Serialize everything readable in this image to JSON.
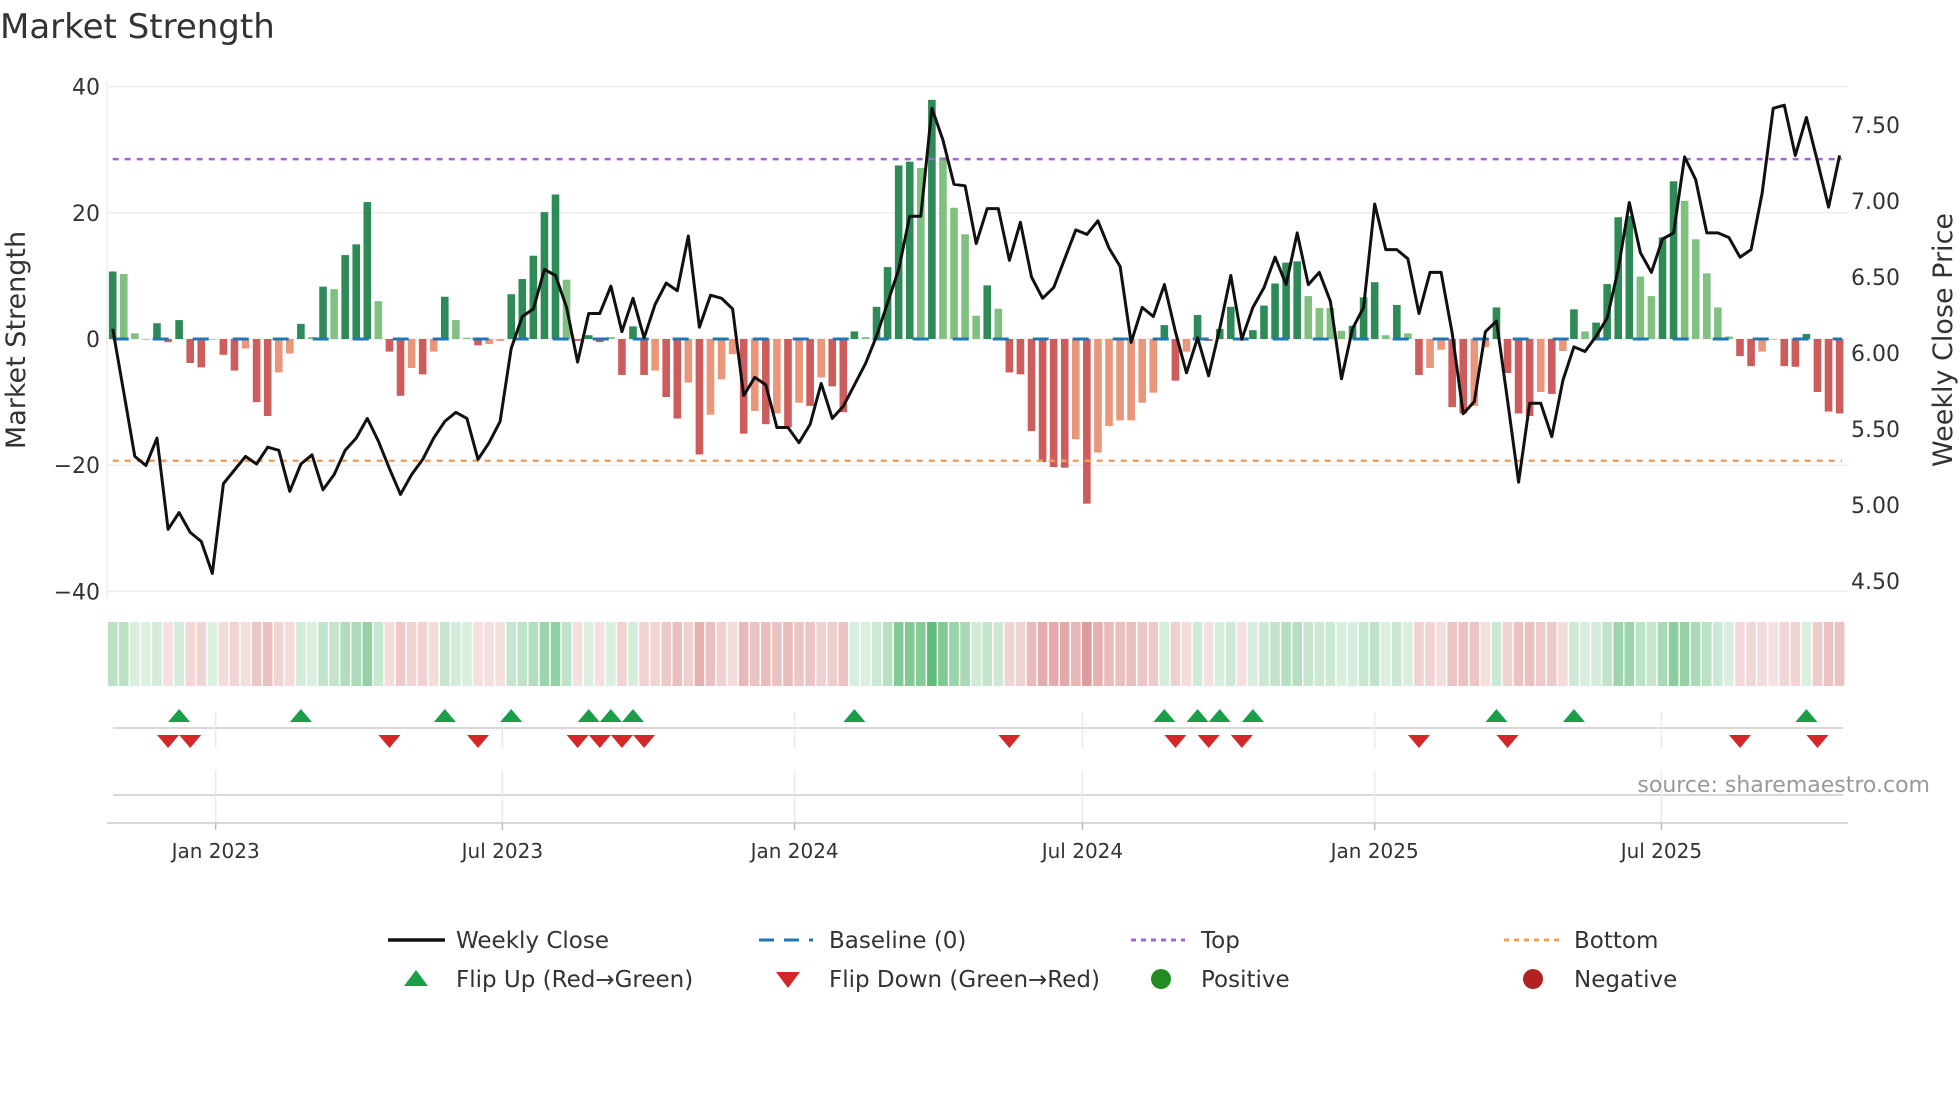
{
  "chart_data": {
    "type": "bar",
    "title": "Market Strength",
    "ylabel": "Market Strength",
    "y2label": "Weekly Close Price",
    "ylim": [
      -40,
      40
    ],
    "y2lim": [
      4.5,
      7.6
    ],
    "yticks": [
      "40",
      "20",
      "0",
      "−20",
      "−40"
    ],
    "ytick_values": [
      40,
      20,
      0,
      -20,
      -40
    ],
    "y2ticks": [
      "7.50",
      "7.00",
      "6.50",
      "6.00",
      "5.50",
      "5.00",
      "4.50"
    ],
    "y2tick_values": [
      7.5,
      7.0,
      6.5,
      6.0,
      5.5,
      5.0,
      4.5
    ],
    "xticks": [
      "Jan 2023",
      "Jul 2023",
      "Jan 2024",
      "Jul 2024",
      "Jan 2025",
      "Jul 2025"
    ],
    "xtick_week_index": [
      9.3,
      35.2,
      61.6,
      87.6,
      114.0,
      139.9
    ],
    "grid": true,
    "top_level": 28.5,
    "bottom_level": -19.3,
    "baseline": 0,
    "strength": [
      10.7,
      10.3,
      0.9,
      0,
      2.5,
      -0.5,
      3.0,
      -3.8,
      -4.5,
      0,
      -2.5,
      -5,
      -1.5,
      -10,
      -12.2,
      -5.3,
      -2.3,
      2.4,
      0.3,
      8.3,
      7.9,
      13.3,
      15,
      21.7,
      6,
      -2,
      -9,
      -4.6,
      -5.6,
      -2,
      6.7,
      3,
      0.2,
      -1,
      -0.8,
      -0.3,
      7.1,
      9.5,
      13.2,
      20.1,
      22.9,
      9.4,
      -0.3,
      0.6,
      -0.5,
      0.3,
      -5.7,
      2,
      -5.7,
      -5,
      -9.2,
      -12.6,
      -6.9,
      -18.3,
      -12,
      -6.4,
      -2.4,
      -15,
      -11.4,
      -13.5,
      -11.8,
      -14,
      -10.1,
      -10.6,
      -6.1,
      -7.5,
      -11.6,
      1.2,
      0.3,
      5.1,
      11.4,
      27.5,
      28.1,
      27.1,
      37.9,
      28.8,
      20.8,
      16.6,
      3.7,
      8.5,
      4.8,
      -5.3,
      -5.6,
      -14.6,
      -19.5,
      -20.3,
      -20.4,
      -15.9,
      -26.1,
      -18,
      -13.8,
      -12.9,
      -12.9,
      -10.1,
      -8.5,
      2.2,
      -6.6,
      -2,
      3.8,
      -0.3,
      1.6,
      5.1,
      -0.2,
      1.4,
      5.3,
      8.8,
      12.1,
      12.3,
      6.8,
      4.9,
      4.9,
      1.3,
      2.1,
      6.6,
      9,
      0.6,
      5.4,
      0.9,
      -5.7,
      -4.6,
      -1.7,
      -10.8,
      -11.8,
      -10.6,
      -1.3,
      5,
      -5.4,
      -11.8,
      -12.2,
      -8.4,
      -8.7,
      -1.9,
      4.7,
      1.2,
      2.6,
      8.7,
      19.3,
      19.5,
      9.9,
      6.8,
      16.1,
      25,
      21.9,
      15.8,
      10.4,
      5,
      0.4,
      -2.7,
      -4.3,
      -2,
      -0.1,
      -4.3,
      -4.4,
      0.8,
      -8.4,
      -11.5,
      -11.8
    ],
    "strength_dark": [
      1,
      0,
      0,
      0,
      1,
      1,
      1,
      1,
      1,
      0,
      1,
      1,
      0,
      1,
      1,
      0,
      0,
      1,
      0,
      1,
      0,
      1,
      1,
      1,
      0,
      1,
      1,
      0,
      1,
      0,
      1,
      0,
      0,
      1,
      0,
      0,
      1,
      1,
      1,
      1,
      1,
      0,
      1,
      1,
      1,
      0,
      1,
      1,
      1,
      0,
      1,
      1,
      0,
      1,
      0,
      0,
      0,
      1,
      0,
      1,
      0,
      1,
      0,
      1,
      0,
      1,
      1,
      1,
      0,
      1,
      1,
      1,
      1,
      0,
      1,
      0,
      0,
      0,
      0,
      1,
      0,
      1,
      1,
      1,
      1,
      1,
      1,
      0,
      1,
      0,
      0,
      0,
      0,
      0,
      0,
      1,
      1,
      0,
      1,
      1,
      1,
      1,
      1,
      1,
      1,
      1,
      1,
      1,
      0,
      0,
      0,
      0,
      1,
      1,
      1,
      0,
      1,
      0,
      1,
      0,
      0,
      1,
      1,
      0,
      0,
      1,
      1,
      1,
      1,
      0,
      1,
      0,
      1,
      0,
      1,
      1,
      1,
      1,
      0,
      0,
      1,
      1,
      0,
      0,
      0,
      0,
      0,
      1,
      1,
      0,
      0,
      1,
      1,
      1,
      1,
      1,
      1
    ],
    "weekly_close": [
      6.16,
      5.74,
      5.32,
      5.26,
      5.44,
      4.84,
      4.95,
      4.82,
      4.76,
      4.55,
      5.14,
      5.23,
      5.32,
      5.27,
      5.38,
      5.36,
      5.09,
      5.27,
      5.33,
      5.1,
      5.2,
      5.36,
      5.44,
      5.57,
      5.42,
      5.24,
      5.07,
      5.2,
      5.3,
      5.44,
      5.55,
      5.61,
      5.57,
      5.3,
      5.41,
      5.55,
      6.03,
      6.24,
      6.29,
      6.55,
      6.51,
      6.3,
      5.94,
      6.26,
      6.26,
      6.44,
      6.14,
      6.36,
      6.1,
      6.32,
      6.46,
      6.41,
      6.77,
      6.17,
      6.38,
      6.36,
      6.29,
      5.72,
      5.84,
      5.79,
      5.51,
      5.51,
      5.41,
      5.53,
      5.8,
      5.57,
      5.65,
      5.79,
      5.93,
      6.11,
      6.33,
      6.55,
      6.9,
      6.9,
      7.61,
      7.4,
      7.11,
      7.1,
      6.72,
      6.95,
      6.95,
      6.61,
      6.86,
      6.5,
      6.36,
      6.43,
      6.62,
      6.81,
      6.78,
      6.87,
      6.69,
      6.57,
      6.07,
      6.3,
      6.24,
      6.45,
      6.14,
      5.87,
      6.1,
      5.85,
      6.16,
      6.51,
      6.09,
      6.3,
      6.43,
      6.63,
      6.45,
      6.79,
      6.45,
      6.53,
      6.34,
      5.83,
      6.16,
      6.3,
      6.98,
      6.68,
      6.68,
      6.62,
      6.26,
      6.53,
      6.53,
      6.13,
      5.6,
      5.68,
      6.14,
      6.21,
      5.69,
      5.15,
      5.67,
      5.67,
      5.45,
      5.82,
      6.04,
      6.01,
      6.11,
      6.23,
      6.55,
      6.99,
      6.66,
      6.53,
      6.75,
      6.79,
      7.29,
      7.14,
      6.79,
      6.79,
      6.76,
      6.63,
      6.68,
      7.05,
      7.61,
      7.63,
      7.3,
      7.55,
      7.26,
      6.96,
      7.3
    ],
    "flip_up_weeks": [
      6,
      17,
      30,
      36,
      43,
      45,
      47,
      67,
      95,
      98,
      100,
      103,
      125,
      132,
      153
    ],
    "flip_down_weeks": [
      5,
      7,
      25,
      33,
      42,
      44,
      46,
      48,
      81,
      96,
      99,
      102,
      118,
      126,
      147,
      154
    ],
    "legend_position": "bottom",
    "legend": {
      "weekly_close": "Weekly Close",
      "baseline": "Baseline (0)",
      "top": "Top",
      "bottom": "Bottom",
      "flip_up": "Flip Up (Red→Green)",
      "flip_down": "Flip Down (Green→Red)",
      "positive": "Positive",
      "negative": "Negative"
    },
    "source": "source: sharemaestro.com"
  },
  "colors": {
    "pos_dark": "#2e8b57",
    "pos_light": "#80c080",
    "neg_dark": "#cd5c5c",
    "neg_light": "#e9967a",
    "price": "#111111",
    "baseline": "#1f77b4",
    "top": "#9e66d8",
    "bottom": "#f0a060",
    "flip_up": "#1a9e4a",
    "flip_down": "#d62728",
    "positive": "#228b22",
    "negative": "#b22222"
  }
}
